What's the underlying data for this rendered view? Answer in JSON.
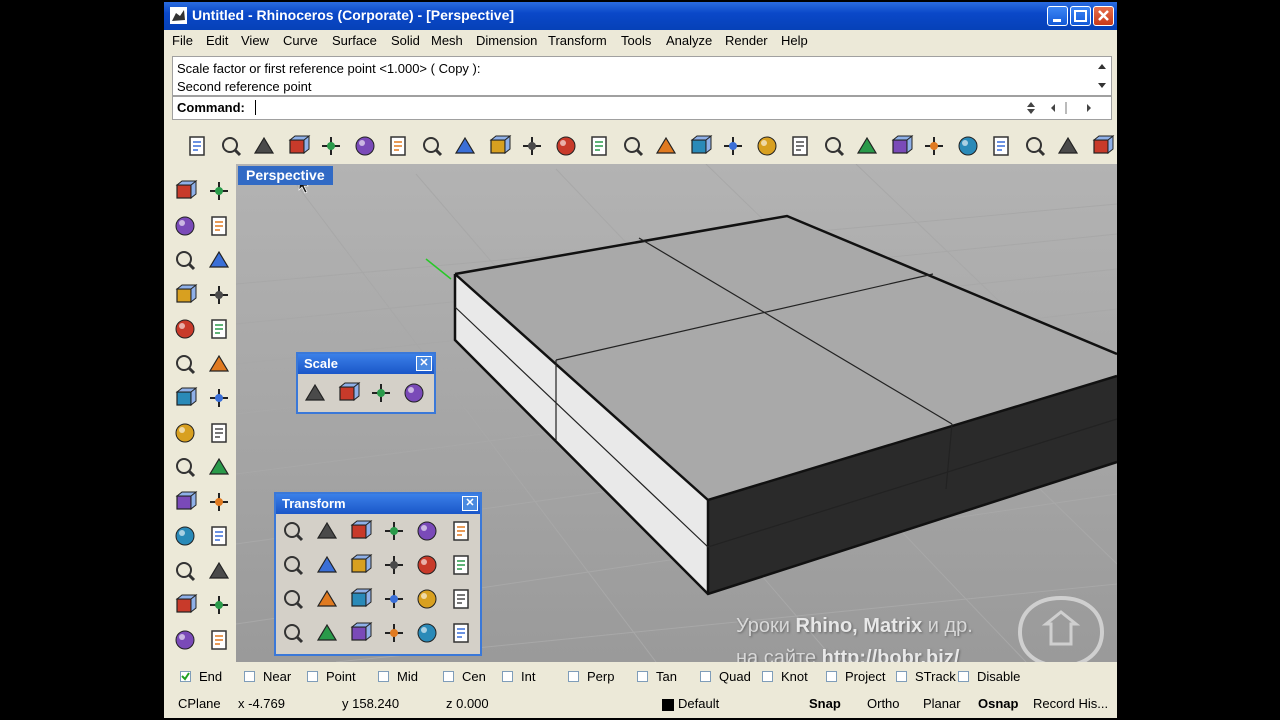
{
  "window": {
    "title": "Untitled - Rhinoceros (Corporate) - [Perspective]"
  },
  "menu": [
    "File",
    "Edit",
    "View",
    "Curve",
    "Surface",
    "Solid",
    "Mesh",
    "Dimension",
    "Transform",
    "Tools",
    "Analyze",
    "Render",
    "Help"
  ],
  "command_history": {
    "line1": "Scale factor or first reference point <1.000> ( Copy ):",
    "line2": "Second reference point"
  },
  "command": {
    "label": "Command:",
    "value": ""
  },
  "toolbar_icons": [
    "new-icon",
    "open-icon",
    "save-icon",
    "print-icon",
    "paste-special-icon",
    "cut-icon",
    "copy-icon",
    "paste-icon",
    "undo-icon",
    "pan-hand-icon",
    "move-view-icon",
    "zoom-icon",
    "zoom-window-icon",
    "zoom-extents-icon",
    "zoom-selected-icon",
    "rotate-view-icon",
    "four-viewports-icon",
    "car-render-icon",
    "grid-icon",
    "cplane-icon",
    "sun-icon",
    "light-bulb-icon",
    "lock-icon",
    "layer-icon",
    "color-wheel-icon",
    "sphere-wire-icon",
    "sphere-shade-icon",
    "sphere-render-icon"
  ],
  "viewport": {
    "tab_label": "Perspective"
  },
  "scale_panel": {
    "title": "Scale",
    "icons": [
      "scale-3d-icon",
      "scale-2d-icon",
      "scale-1d-icon",
      "scale-nu-icon"
    ]
  },
  "transform_panel": {
    "title": "Transform",
    "icons": [
      "move-icon",
      "rotate-icon",
      "array-icon",
      "mirror-icon",
      "scale-3d-icon",
      "flip-icon",
      "orient-icon",
      "align-icon",
      "twist-icon",
      "bend-icon",
      "offset-icon",
      "grid-array-icon",
      "polar-array-icon",
      "taper-icon",
      "array-curve-icon",
      "align-vertical-icon",
      "mirror-vertical-icon",
      "flow-icon",
      "shear-icon",
      "twist-2-icon",
      "skew-icon",
      "wave-icon",
      "smash-icon",
      "project-icon"
    ]
  },
  "osnap": [
    {
      "label": "End",
      "checked": true
    },
    {
      "label": "Near",
      "checked": false
    },
    {
      "label": "Point",
      "checked": false
    },
    {
      "label": "Mid",
      "checked": false
    },
    {
      "label": "Cen",
      "checked": false
    },
    {
      "label": "Int",
      "checked": false
    },
    {
      "label": "Perp",
      "checked": false
    },
    {
      "label": "Tan",
      "checked": false
    },
    {
      "label": "Quad",
      "checked": false
    },
    {
      "label": "Knot",
      "checked": false
    },
    {
      "label": "Project",
      "checked": false
    },
    {
      "label": "STrack",
      "checked": false
    },
    {
      "label": "Disable",
      "checked": false
    }
  ],
  "status": {
    "cplane": "CPlane",
    "x": "x -4.769",
    "y": "y 158.240",
    "z": "z 0.000",
    "layer": "Default",
    "snap": "Snap",
    "ortho": "Ortho",
    "planar": "Planar",
    "osnap": "Osnap",
    "record": "Record His..."
  },
  "watermark": {
    "line1_prefix": "Уроки ",
    "line1_bold": "Rhino, Matrix",
    "line1_suffix": " и др.",
    "line2_prefix": "на сайте ",
    "line2_bold": "http://bobr.biz/"
  },
  "colors": {
    "titlebar": "#0a48c8",
    "chrome": "#ece9d8",
    "viewport_bg": "#9a9a9a",
    "tab_bg": "#316ac5"
  }
}
